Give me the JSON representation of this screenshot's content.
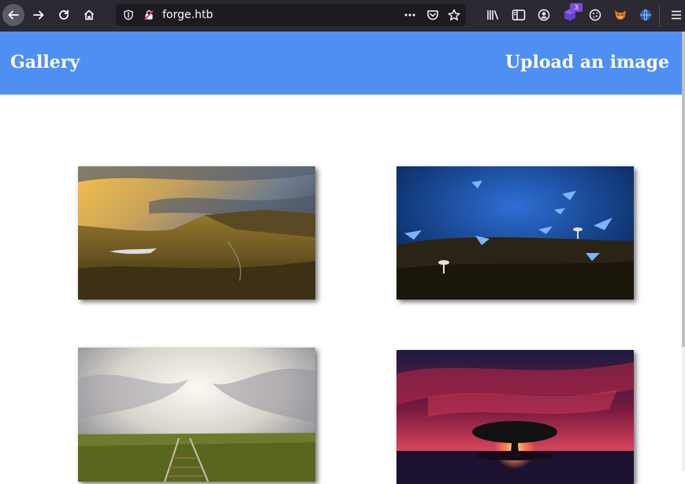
{
  "browser": {
    "url": "forge.htb",
    "extension_badge": "3"
  },
  "page": {
    "header": {
      "title": "Gallery",
      "upload_link": "Upload an image"
    },
    "gallery": [
      {
        "subject": "mountain valley at sunset"
      },
      {
        "subject": "blue butterflies and mushrooms in dark forest"
      },
      {
        "subject": "railway tracks through grass under cloudy sky"
      },
      {
        "subject": "lone tree silhouette against red sky"
      }
    ]
  },
  "colors": {
    "toolbar_bg": "#2b2a33",
    "urlbar_bg": "#1c1b22",
    "header_bg": "#4f8ff2",
    "header_text": "#ffffff"
  }
}
